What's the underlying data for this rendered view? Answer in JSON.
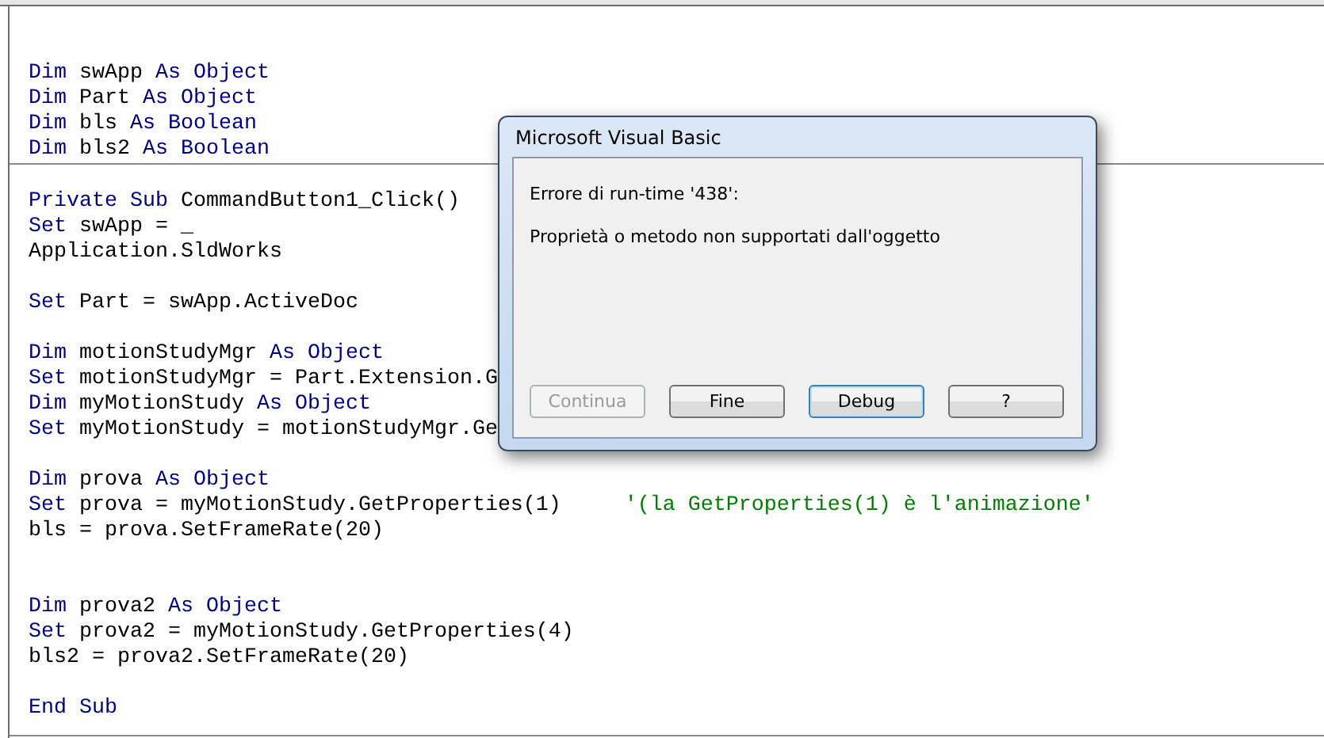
{
  "editor": {
    "sections": [
      {
        "lines": [
          {
            "kind": "code",
            "tokens": [
              {
                "kind": "keyword",
                "text": "Dim"
              },
              {
                "kind": "plain",
                "text": " swApp "
              },
              {
                "kind": "keyword",
                "text": "As Object"
              }
            ]
          },
          {
            "kind": "code",
            "tokens": [
              {
                "kind": "keyword",
                "text": "Dim"
              },
              {
                "kind": "plain",
                "text": " Part "
              },
              {
                "kind": "keyword",
                "text": "As Object"
              }
            ]
          },
          {
            "kind": "code",
            "tokens": [
              {
                "kind": "keyword",
                "text": "Dim"
              },
              {
                "kind": "plain",
                "text": " bls "
              },
              {
                "kind": "keyword",
                "text": "As Boolean"
              }
            ]
          },
          {
            "kind": "code",
            "tokens": [
              {
                "kind": "keyword",
                "text": "Dim"
              },
              {
                "kind": "plain",
                "text": " bls2 "
              },
              {
                "kind": "keyword",
                "text": "As Boolean"
              }
            ]
          }
        ]
      },
      {
        "lines": [
          {
            "kind": "blank"
          },
          {
            "kind": "code",
            "tokens": [
              {
                "kind": "keyword",
                "text": "Private Sub"
              },
              {
                "kind": "plain",
                "text": " CommandButton1_Click()"
              }
            ]
          },
          {
            "kind": "code",
            "tokens": [
              {
                "kind": "keyword",
                "text": "Set"
              },
              {
                "kind": "plain",
                "text": " swApp = _"
              }
            ]
          },
          {
            "kind": "code",
            "tokens": [
              {
                "kind": "plain",
                "text": "Application.SldWorks"
              }
            ]
          },
          {
            "kind": "blank"
          },
          {
            "kind": "code",
            "tokens": [
              {
                "kind": "keyword",
                "text": "Set"
              },
              {
                "kind": "plain",
                "text": " Part = swApp.ActiveDoc"
              }
            ]
          },
          {
            "kind": "blank"
          },
          {
            "kind": "code",
            "tokens": [
              {
                "kind": "keyword",
                "text": "Dim"
              },
              {
                "kind": "plain",
                "text": " motionStudyMgr "
              },
              {
                "kind": "keyword",
                "text": "As Object"
              }
            ]
          },
          {
            "kind": "code",
            "tokens": [
              {
                "kind": "keyword",
                "text": "Set"
              },
              {
                "kind": "plain",
                "text": " motionStudyMgr = Part.Extension.G"
              }
            ]
          },
          {
            "kind": "code",
            "tokens": [
              {
                "kind": "keyword",
                "text": "Dim"
              },
              {
                "kind": "plain",
                "text": " myMotionStudy "
              },
              {
                "kind": "keyword",
                "text": "As Object"
              }
            ]
          },
          {
            "kind": "code",
            "tokens": [
              {
                "kind": "keyword",
                "text": "Set"
              },
              {
                "kind": "plain",
                "text": " myMotionStudy = motionStudyMgr.Ge"
              }
            ]
          },
          {
            "kind": "blank"
          },
          {
            "kind": "code",
            "tokens": [
              {
                "kind": "keyword",
                "text": "Dim"
              },
              {
                "kind": "plain",
                "text": " prova "
              },
              {
                "kind": "keyword",
                "text": "As Object"
              }
            ]
          },
          {
            "kind": "code",
            "tokens": [
              {
                "kind": "keyword",
                "text": "Set"
              },
              {
                "kind": "plain",
                "text": " prova = myMotionStudy.GetProperties(1)     "
              },
              {
                "kind": "comment",
                "text": "'(la GetProperties(1) è l'animazione'"
              }
            ]
          },
          {
            "kind": "code",
            "tokens": [
              {
                "kind": "plain",
                "text": "bls = prova.SetFrameRate(20)"
              }
            ]
          },
          {
            "kind": "blank"
          },
          {
            "kind": "blank"
          },
          {
            "kind": "code",
            "tokens": [
              {
                "kind": "keyword",
                "text": "Dim"
              },
              {
                "kind": "plain",
                "text": " prova2 "
              },
              {
                "kind": "keyword",
                "text": "As Object"
              }
            ]
          },
          {
            "kind": "code",
            "tokens": [
              {
                "kind": "keyword",
                "text": "Set"
              },
              {
                "kind": "plain",
                "text": " prova2 = myMotionStudy.GetProperties(4)"
              }
            ]
          },
          {
            "kind": "code",
            "tokens": [
              {
                "kind": "plain",
                "text": "bls2 = prova2.SetFrameRate(20)"
              }
            ]
          },
          {
            "kind": "blank"
          },
          {
            "kind": "code",
            "tokens": [
              {
                "kind": "keyword",
                "text": "End Sub"
              }
            ]
          }
        ]
      }
    ]
  },
  "dialog": {
    "title": "Microsoft Visual Basic",
    "messages": [
      "Errore di run-time '438':",
      "Proprietà o metodo non supportati dall'oggetto"
    ],
    "buttons": [
      {
        "label": "Continua",
        "disabled": true,
        "focused": false
      },
      {
        "label": "Fine",
        "disabled": false,
        "focused": false
      },
      {
        "label": "Debug",
        "disabled": false,
        "focused": true
      },
      {
        "label": "?",
        "disabled": false,
        "focused": false
      }
    ]
  }
}
